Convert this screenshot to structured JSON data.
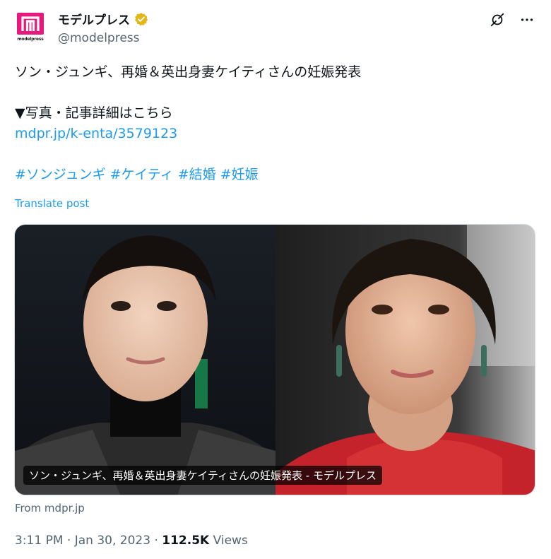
{
  "account": {
    "display_name": "モデルプレス",
    "handle": "@modelpress",
    "avatar_brand_text": "modelpress",
    "verified_color": "#e2b719",
    "brand_color": "#e6197c"
  },
  "post": {
    "line1": "ソン・ジュンギ、再婚＆英出身妻ケイティさんの妊娠発表",
    "line2": "▼写真・記事詳細はこちら",
    "link": "mdpr.jp/k-enta/3579123",
    "hashtags": [
      "#ソンジュンギ",
      "#ケイティ",
      "#結婚",
      "#妊娠"
    ],
    "translate_label": "Translate post"
  },
  "media": {
    "caption": "ソン・ジュンギ、再婚＆英出身妻ケイティさんの妊娠発表 - モデルプレス",
    "source": "From mdpr.jp"
  },
  "meta": {
    "time": "3:11 PM",
    "date": "Jan 30, 2023",
    "views_count": "112.5K",
    "views_label": "Views",
    "separator": "·"
  },
  "icons": {
    "grok": "grok-icon",
    "more": "more-icon",
    "verified": "verified-badge-icon"
  },
  "colors": {
    "link": "#1d9bf0",
    "secondary_text": "#536471",
    "primary_text": "#0f1419"
  }
}
